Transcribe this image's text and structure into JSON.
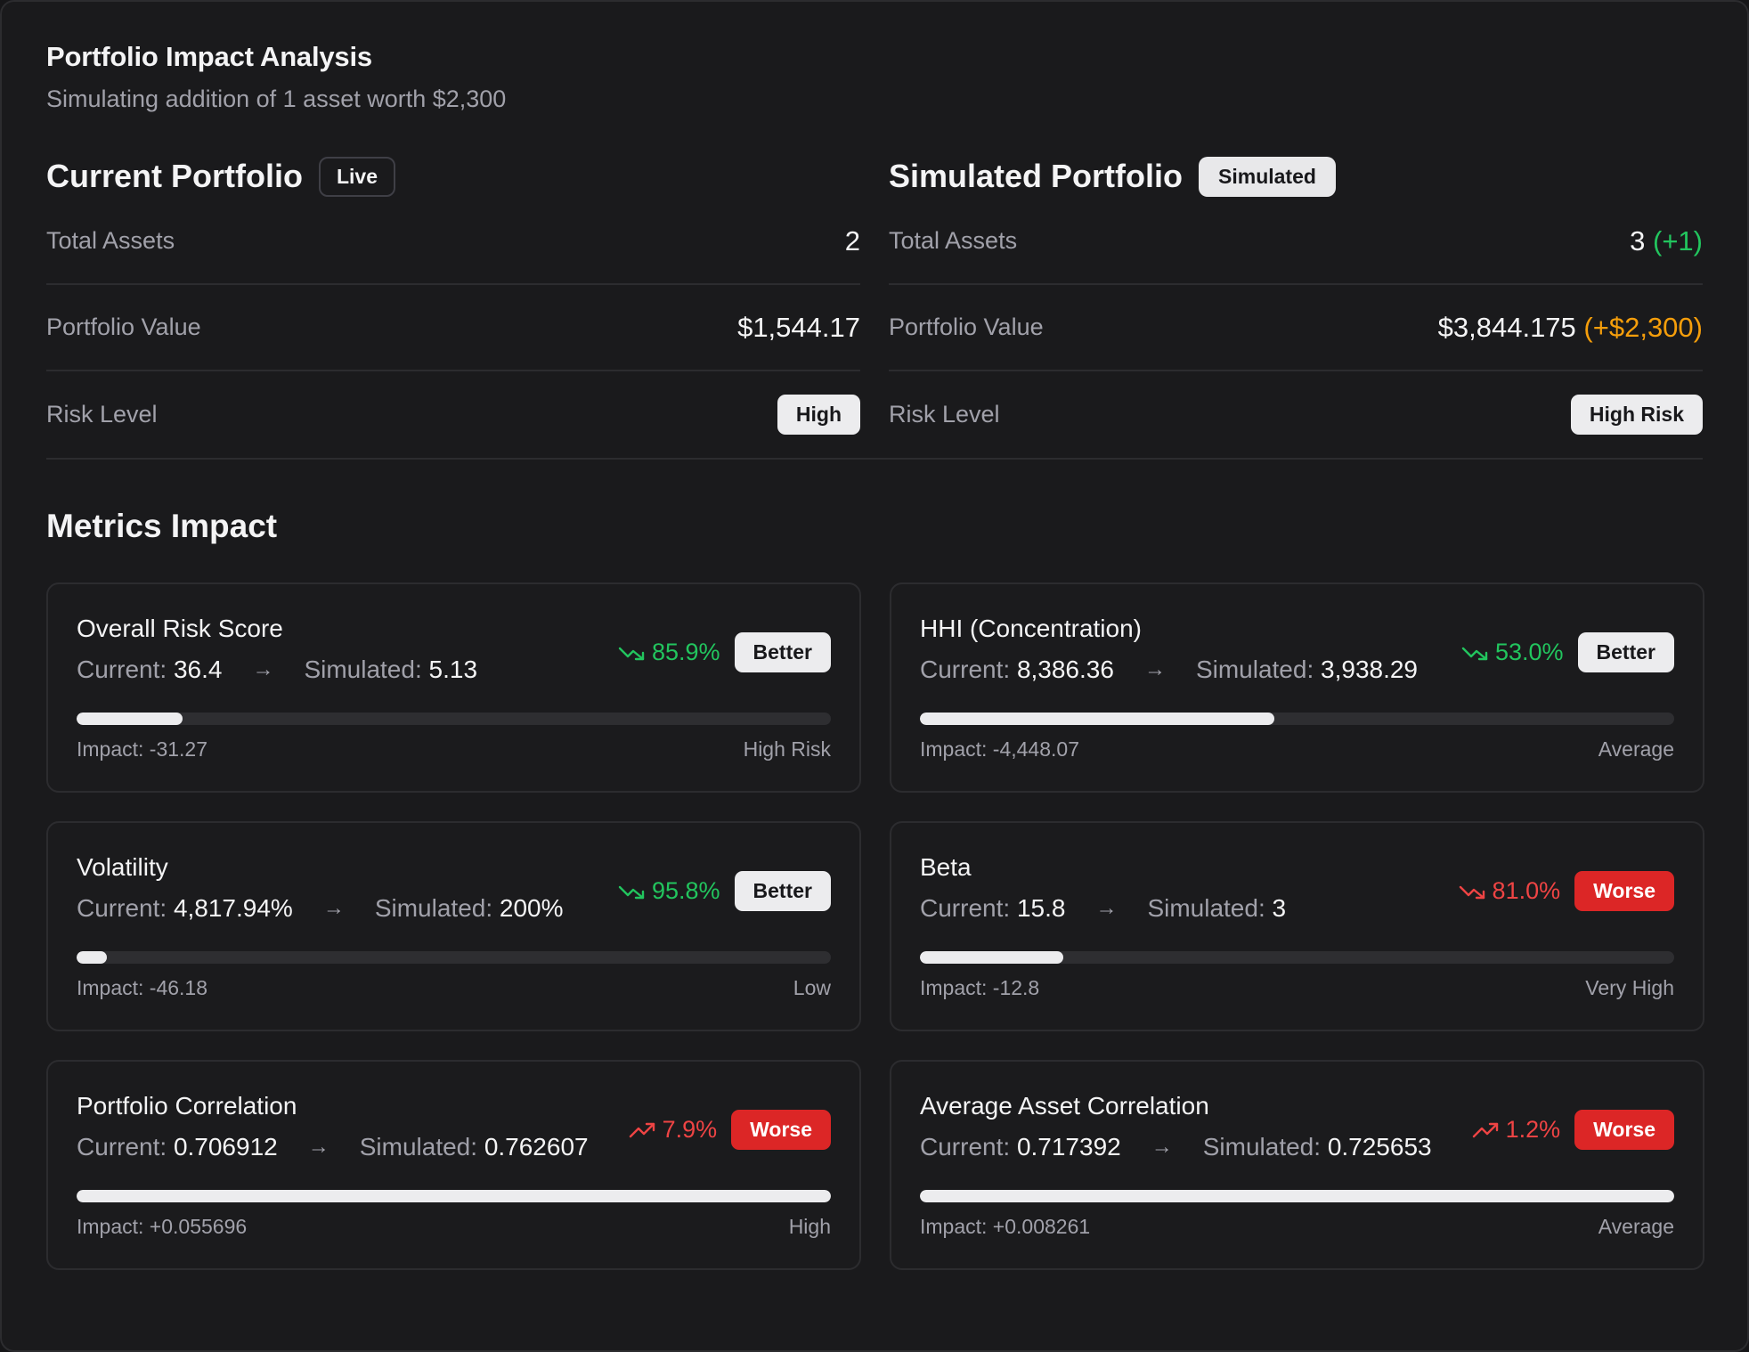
{
  "header": {
    "title": "Portfolio Impact Analysis",
    "subtitle": "Simulating addition of 1 asset worth $2,300"
  },
  "current": {
    "title": "Current Portfolio",
    "badge": "Live",
    "rows": {
      "total_assets_label": "Total Assets",
      "total_assets_value": "2",
      "portfolio_value_label": "Portfolio Value",
      "portfolio_value": "$1,544.17",
      "risk_label": "Risk Level",
      "risk_value": "High"
    }
  },
  "simulated": {
    "title": "Simulated Portfolio",
    "badge": "Simulated",
    "rows": {
      "total_assets_label": "Total Assets",
      "total_assets_value": "3",
      "total_assets_delta": "(+1)",
      "portfolio_value_label": "Portfolio Value",
      "portfolio_value": "$3,844.175",
      "portfolio_value_delta": "(+$2,300)",
      "risk_label": "Risk Level",
      "risk_value": "High Risk"
    }
  },
  "metrics": {
    "title": "Metrics Impact",
    "current_prefix": "Current:",
    "simulated_prefix": "Simulated:",
    "items": [
      {
        "name": "Overall Risk Score",
        "current": "36.4",
        "simulated": "5.13",
        "pct": "85.9%",
        "direction": "down",
        "status": "Better",
        "impact": "Impact: -31.27",
        "level": "High Risk",
        "fill": 0.14
      },
      {
        "name": "HHI (Concentration)",
        "current": "8,386.36",
        "simulated": "3,938.29",
        "pct": "53.0%",
        "direction": "down",
        "status": "Better",
        "impact": "Impact: -4,448.07",
        "level": "Average",
        "fill": 0.47
      },
      {
        "name": "Volatility",
        "current": "4,817.94%",
        "simulated": "200%",
        "pct": "95.8%",
        "direction": "down",
        "status": "Better",
        "impact": "Impact: -46.18",
        "level": "Low",
        "fill": 0.04
      },
      {
        "name": "Beta",
        "current": "15.8",
        "simulated": "3",
        "pct": "81.0%",
        "direction": "down",
        "status": "Worse",
        "impact": "Impact: -12.8",
        "level": "Very High",
        "fill": 0.19
      },
      {
        "name": "Portfolio Correlation",
        "current": "0.706912",
        "simulated": "0.762607",
        "pct": "7.9%",
        "direction": "up",
        "status": "Worse",
        "impact": "Impact: +0.055696",
        "level": "High",
        "fill": 1.0
      },
      {
        "name": "Average Asset Correlation",
        "current": "0.717392",
        "simulated": "0.725653",
        "pct": "1.2%",
        "direction": "up",
        "status": "Worse",
        "impact": "Impact: +0.008261",
        "level": "Average",
        "fill": 1.0
      }
    ]
  },
  "colors": {
    "good": "#22c55e",
    "bad": "#ef4444",
    "delta_value": "#f59e0b",
    "worse_tag": "#dc2626"
  },
  "icons": {
    "arrow": "arrow-right-icon",
    "trend_down": "trending-down-icon",
    "trend_up": "trending-up-icon"
  }
}
